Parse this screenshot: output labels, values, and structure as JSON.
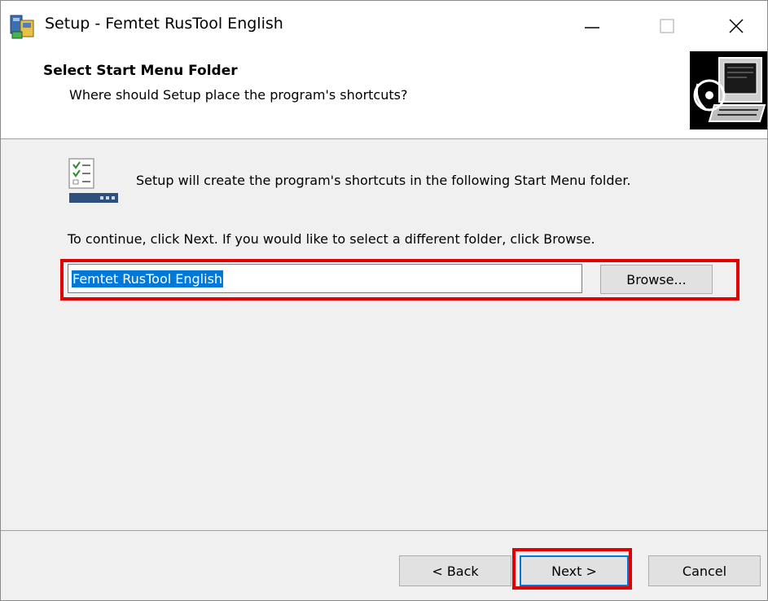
{
  "window": {
    "title": "Setup - Femtet RusTool English",
    "controls": [
      "minimize",
      "maximize",
      "close"
    ]
  },
  "header": {
    "title": "Select Start Menu Folder",
    "subtitle": "Where should Setup place the program's shortcuts?",
    "image_icon": "install-computer-icon"
  },
  "body": {
    "icon": "start-menu-folder-icon",
    "intro": "Setup will create the program's shortcuts in the following Start Menu folder.",
    "instruction": "To continue, click Next. If you would like to select a different folder, click Browse.",
    "folder_value": "Femtet RusTool English",
    "browse_label": "Browse..."
  },
  "footer": {
    "back_label": "< Back",
    "next_label": "Next >",
    "cancel_label": "Cancel"
  },
  "colors": {
    "highlight": "#e30000",
    "selection": "#0078d7",
    "dialog_bg": "#f0f0f0"
  }
}
